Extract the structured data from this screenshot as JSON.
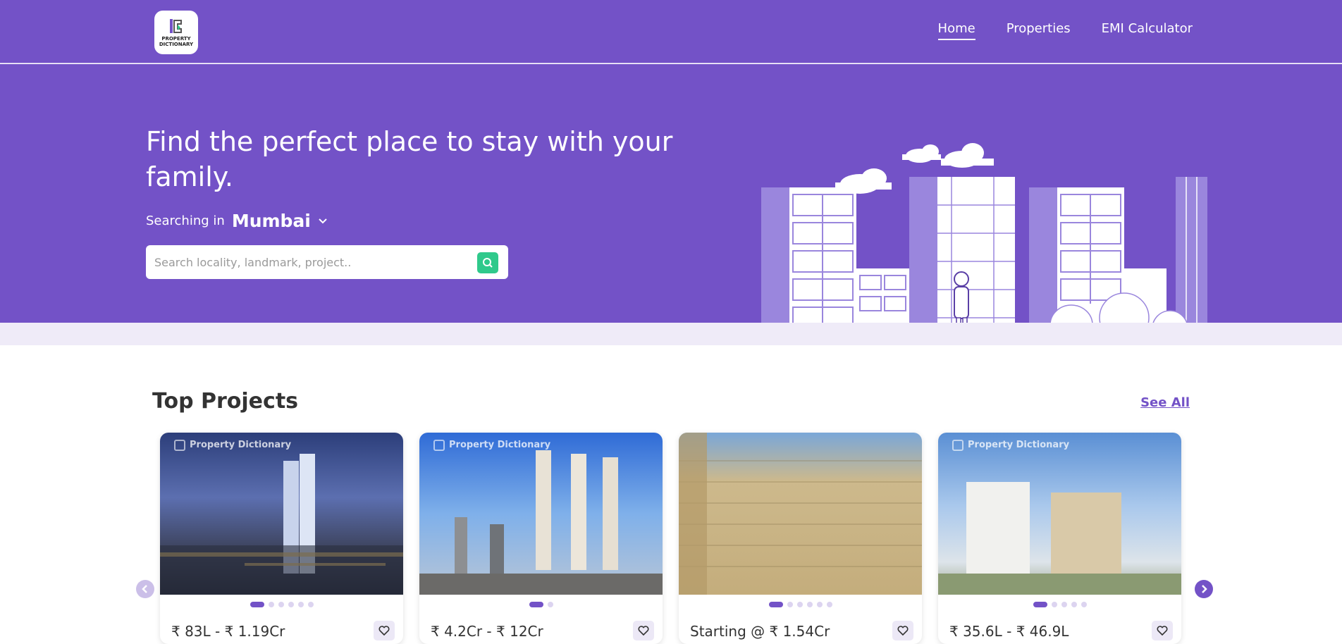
{
  "header": {
    "logo_text": "PROPERTY DICTIONARY",
    "nav": [
      {
        "label": "Home",
        "active": true
      },
      {
        "label": "Properties",
        "active": false
      },
      {
        "label": "EMI Calculator",
        "active": false
      }
    ]
  },
  "hero": {
    "headline": "Find the perfect place to stay with your family.",
    "searching_label": "Searching in",
    "city": "Mumbai",
    "search_placeholder": "Search locality, landmark, project..",
    "icons": {
      "search": "search-icon",
      "dropdown": "chevron-down-icon"
    }
  },
  "projects": {
    "title": "Top Projects",
    "see_all": "See All",
    "watermark": "Property Dictionary",
    "cards": [
      {
        "price": "₹ 83L - ₹ 1.19Cr",
        "dots": 6,
        "active_dot": 0,
        "watermark": true
      },
      {
        "price": "₹ 4.2Cr - ₹ 12Cr",
        "dots": 2,
        "active_dot": 0,
        "watermark": true
      },
      {
        "price": "Starting @ ₹ 1.54Cr",
        "dots": 6,
        "active_dot": 0,
        "watermark": false
      },
      {
        "price": "₹ 35.6L - ₹ 46.9L",
        "dots": 5,
        "active_dot": 0,
        "watermark": true
      }
    ]
  },
  "colors": {
    "brand": "#7352c7",
    "accent_green": "#2fc98b",
    "hero_band": "#efebf8"
  }
}
